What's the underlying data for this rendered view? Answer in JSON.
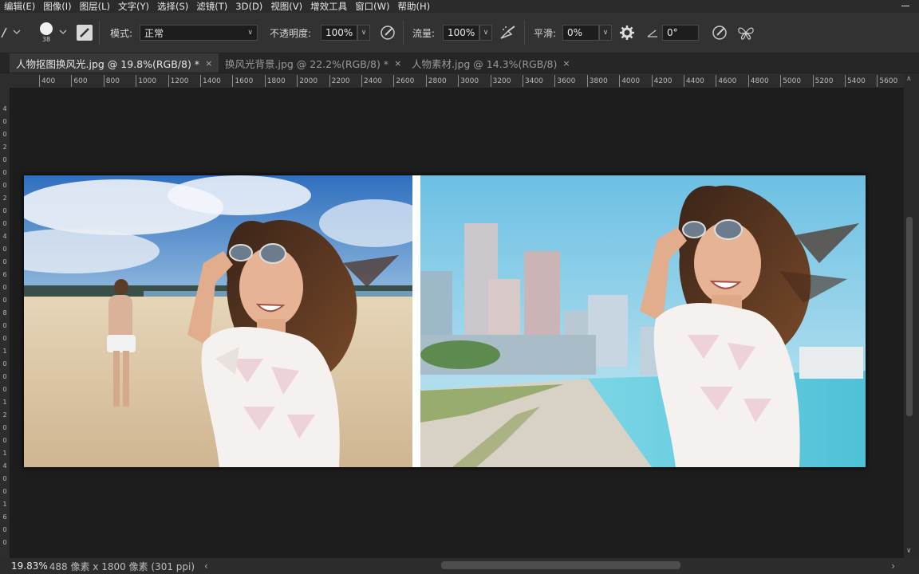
{
  "menu": [
    "编辑(E)",
    "图像(I)",
    "图层(L)",
    "文字(Y)",
    "选择(S)",
    "滤镜(T)",
    "3D(D)",
    "视图(V)",
    "增效工具",
    "窗口(W)",
    "帮助(H)"
  ],
  "options": {
    "brush_size": "38",
    "mode_label": "模式:",
    "mode_value": "正常",
    "opacity_label": "不透明度:",
    "opacity_value": "100%",
    "flow_label": "流量:",
    "flow_value": "100%",
    "smoothing_label": "平滑:",
    "smoothing_value": "0%",
    "angle_value": "0°"
  },
  "tabs": [
    {
      "label": "人物抠图换风光.jpg @ 19.8%(RGB/8) *",
      "active": true
    },
    {
      "label": "换风光背景.jpg @ 22.2%(RGB/8) *",
      "active": false
    },
    {
      "label": "人物素材.jpg @ 14.3%(RGB/8)",
      "active": false
    }
  ],
  "ruler_h": [
    "400",
    "600",
    "800",
    "1000",
    "1200",
    "1400",
    "1600",
    "1800",
    "2000",
    "2200",
    "2400",
    "2600",
    "2800",
    "3000",
    "3200",
    "3400",
    "3600",
    "3800",
    "4000",
    "4200",
    "4400",
    "4600",
    "4800",
    "5000",
    "5200",
    "5400",
    "5600"
  ],
  "ruler_v": [
    "4",
    "0",
    "0",
    "2",
    "0",
    "0",
    "0",
    "2",
    "0",
    "0",
    "4",
    "0",
    "0",
    "6",
    "0",
    "0",
    "8",
    "0",
    "0",
    "1",
    "0",
    "0",
    "0",
    "1",
    "2",
    "0",
    "0",
    "1",
    "4",
    "0",
    "0",
    "1",
    "6",
    "0",
    "0"
  ],
  "status": {
    "zoom": "19.83%",
    "size": "488 像素 x 1800 像素 (301 ppi)"
  },
  "colors": {
    "sky_left": "#3f7fc4",
    "sky_right": "#7ec8e6",
    "sand": "#d9c4a3",
    "water": "#5fc7d9"
  }
}
